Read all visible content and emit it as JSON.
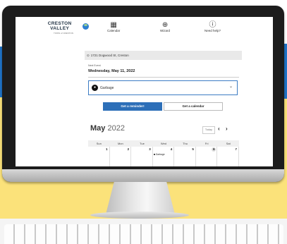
{
  "app": {
    "brand": "CRESTON VALLEY",
    "brand_sub": "TOWN of CRESTON"
  },
  "nav": [
    {
      "label": "Calendar",
      "icon": "calendar-icon"
    },
    {
      "label": "Wizard",
      "icon": "magnifier-icon"
    },
    {
      "label": "Need help?",
      "icon": "help-icon"
    }
  ],
  "address": "1721 Dogwood St, Creston",
  "next_event": {
    "label": "Next Event",
    "date": "Wednesday, May 11, 2022"
  },
  "collection_select": {
    "value": "Garbage"
  },
  "buttons": {
    "reminder": "Get a reminder!",
    "calendar": "Get a calendar"
  },
  "calendar": {
    "month": "May",
    "year": "2022",
    "today_label": "Today",
    "weekdays": [
      "Sun",
      "Mon",
      "Tue",
      "Wed",
      "Thu",
      "Fri",
      "Sat"
    ],
    "days": [
      {
        "num": "1",
        "event": ""
      },
      {
        "num": "2",
        "event": ""
      },
      {
        "num": "3",
        "event": ""
      },
      {
        "num": "4",
        "event": "Garbage"
      },
      {
        "num": "5",
        "event": ""
      },
      {
        "num": "6",
        "event": "",
        "today": true
      },
      {
        "num": "7",
        "event": ""
      }
    ]
  },
  "colors": {
    "accent_blue": "#2d6fb8",
    "bg_yellow": "#fbe27a",
    "bg_blue": "#1f74c8"
  }
}
